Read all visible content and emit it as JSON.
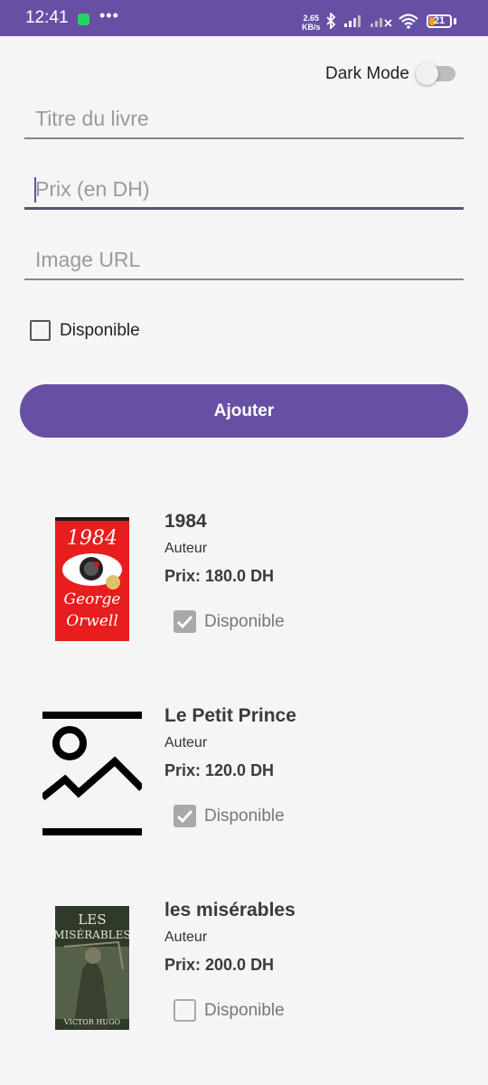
{
  "status": {
    "time": "12:41",
    "net_speed_value": "2.65",
    "net_speed_unit": "KB/s",
    "battery": "21"
  },
  "form": {
    "dark_mode_label": "Dark Mode",
    "dark_mode_on": false,
    "title_placeholder": "Titre du livre",
    "price_placeholder": "Prix (en DH)",
    "image_placeholder": "Image URL",
    "available_label": "Disponible",
    "available_checked": false,
    "add_button": "Ajouter"
  },
  "books": [
    {
      "title": "1984",
      "author": "Auteur",
      "price": "Prix: 180.0 DH",
      "available_label": "Disponible",
      "available": true,
      "cover": "book-cover-1984"
    },
    {
      "title": "Le Petit Prince",
      "author": "Auteur",
      "price": "Prix: 120.0 DH",
      "available_label": "Disponible",
      "available": true,
      "cover": "image-placeholder-icon"
    },
    {
      "title": "les misérables",
      "author": "Auteur",
      "price": "Prix: 200.0 DH",
      "available_label": "Disponible",
      "available": false,
      "cover": "book-cover-les-miserables"
    }
  ],
  "covers": {
    "c1984": {
      "top": "1984",
      "line1": "George",
      "line2": "Orwell"
    },
    "miserables": {
      "line1": "LES",
      "line2": "MISÉRABLES",
      "author": "VICTOR HUGO"
    }
  },
  "colors": {
    "accent": "#6750a4",
    "background": "#f5f5f5",
    "check": "#a9a9a9"
  }
}
